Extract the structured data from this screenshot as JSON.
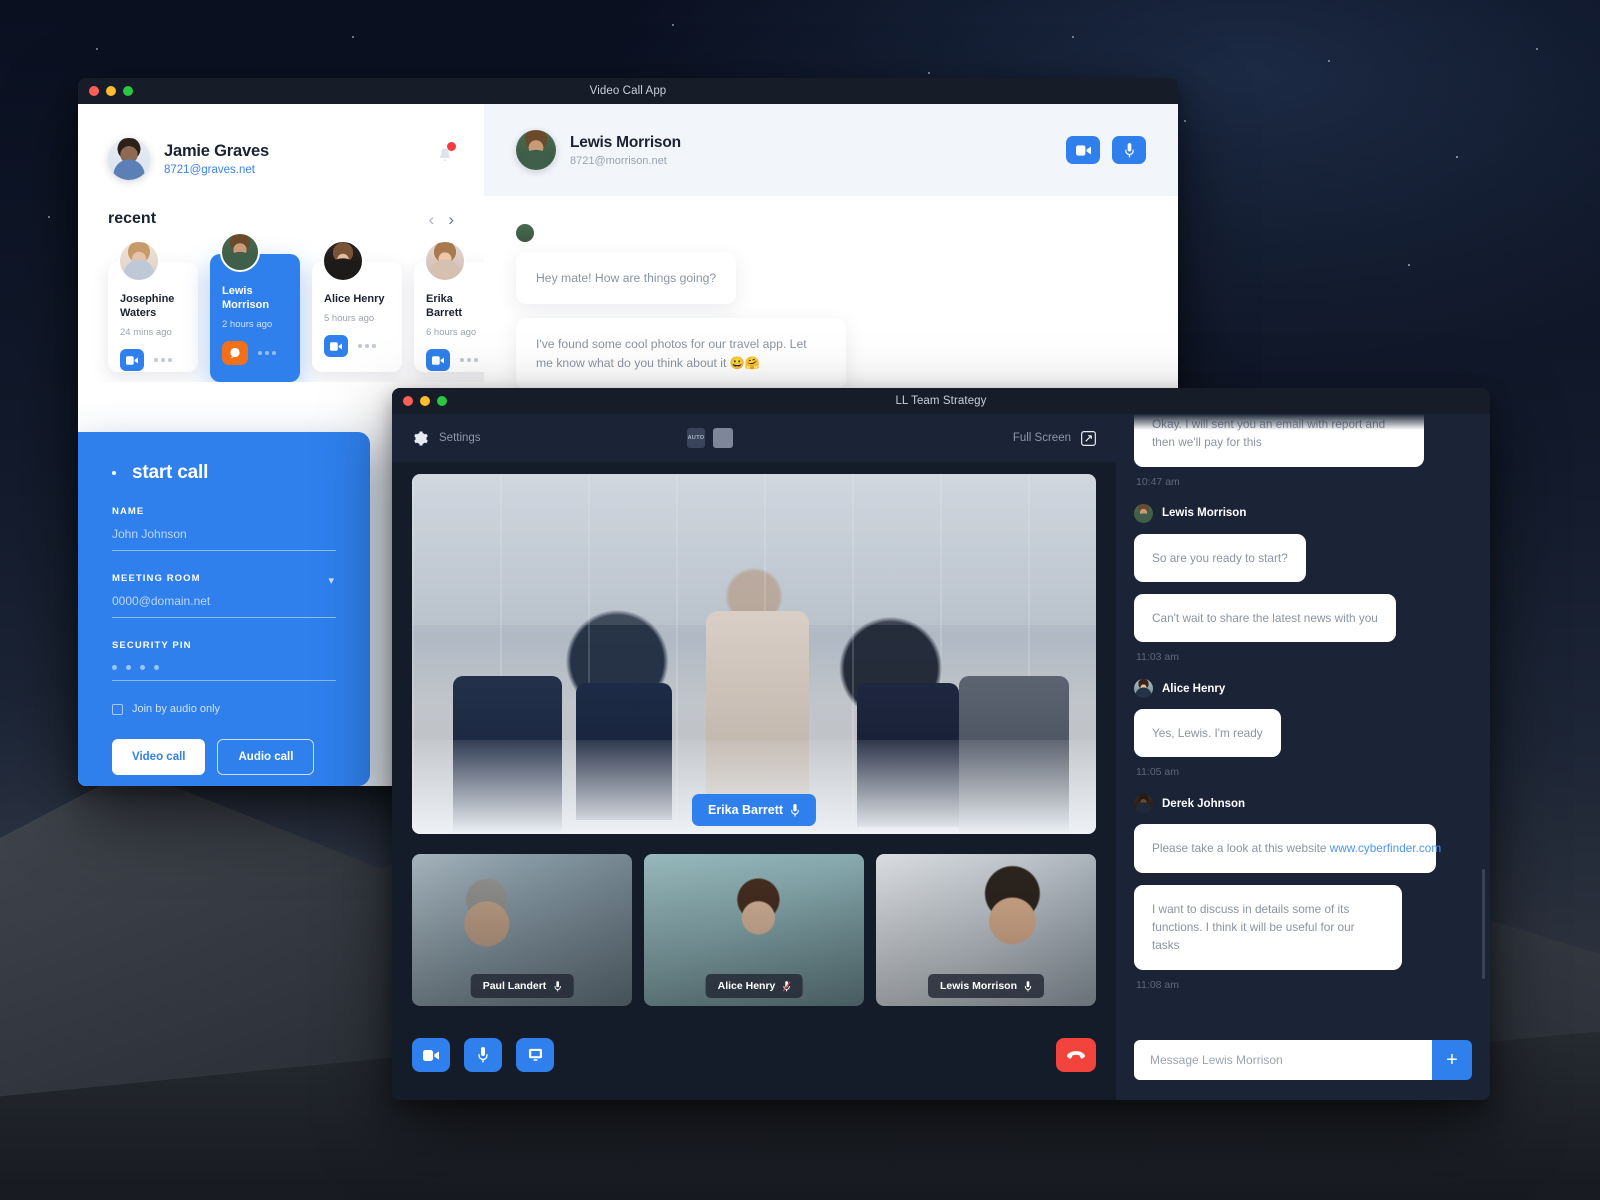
{
  "messenger_window": {
    "title": "Video Call App",
    "profile": {
      "name": "Jamie Graves",
      "handle": "8721@graves.net",
      "avatar_icon": "avatar-jamie",
      "bell_icon": "bell-icon"
    },
    "recent": {
      "heading": "recent",
      "prev_icon": "chevron-left-icon",
      "next_icon": "chevron-right-icon",
      "contacts": [
        {
          "name": "Josephine Waters",
          "time": "24 mins ago",
          "action_icon": "video-camera-icon",
          "more_icon": "more-dots-icon"
        },
        {
          "name": "Lewis Morrison",
          "time": "2 hours ago",
          "action_icon": "chat-bubble-icon",
          "more_icon": "more-dots-icon"
        },
        {
          "name": "Alice Henry",
          "time": "5 hours ago",
          "action_icon": "video-camera-icon",
          "more_icon": "more-dots-icon"
        },
        {
          "name": "Erika Barrett",
          "time": "6 hours ago",
          "action_icon": "video-camera-icon",
          "more_icon": "more-dots-icon"
        }
      ]
    },
    "start_call": {
      "title": "start call",
      "name_label": "NAME",
      "name_placeholder": "John Johnson",
      "room_label": "MEETING ROOM",
      "room_placeholder": "0000@domain.net",
      "room_chevron_icon": "chevron-down-icon",
      "pin_label": "SECURITY PIN",
      "pin_dots": 4,
      "audio_only_label": "Join by audio only",
      "video_call_button": "Video call",
      "audio_call_button": "Audio call"
    },
    "chat": {
      "peer_name": "Lewis Morrison",
      "peer_handle": "8721@morrison.net",
      "video_button_icon": "video-camera-icon",
      "mic_button_icon": "microphone-icon",
      "messages": [
        {
          "text": "Hey mate! How are things going?"
        },
        {
          "text": "I've found some cool photos for our travel app. Let me know what do you think about it 😀🤗"
        }
      ]
    }
  },
  "call_window": {
    "title": "LL Team Strategy",
    "toolbar": {
      "settings_label": "Settings",
      "settings_icon": "gear-icon",
      "fullscreen_label": "Full Screen",
      "fullscreen_icon": "expand-icon",
      "layouts": [
        {
          "name": "layout-auto",
          "label": "AUTO"
        },
        {
          "name": "layout-single",
          "label": ""
        },
        {
          "name": "layout-speaker",
          "label": ""
        },
        {
          "name": "layout-grid-2x2",
          "label": ""
        },
        {
          "name": "layout-grid-sidebar",
          "label": ""
        }
      ],
      "active_layout": "layout-speaker"
    },
    "main_speaker": {
      "name": "Erika Barrett",
      "mic_icon": "microphone-icon",
      "muted": false
    },
    "thumbnails": [
      {
        "name": "Paul Landert",
        "mic_icon": "microphone-icon",
        "muted": false
      },
      {
        "name": "Alice Henry",
        "mic_icon": "microphone-muted-icon",
        "muted": true
      },
      {
        "name": "Lewis Morrison",
        "mic_icon": "microphone-icon",
        "muted": false
      }
    ],
    "controls": [
      {
        "name": "toggle-video-button",
        "icon": "video-camera-icon"
      },
      {
        "name": "toggle-mic-button",
        "icon": "microphone-icon"
      },
      {
        "name": "share-screen-button",
        "icon": "screen-share-icon"
      },
      {
        "name": "end-call-button",
        "icon": "hang-up-icon"
      }
    ],
    "chat": {
      "messages": [
        {
          "type": "bubble",
          "text": "Okay. I will sent you an email with report and then we'll pay for this",
          "clipped": true
        },
        {
          "type": "time",
          "text": "10:47 am"
        },
        {
          "type": "author",
          "name": "Lewis Morrison",
          "avatar_icon": "avatar-lewis"
        },
        {
          "type": "bubble",
          "text": "So are you ready to start?"
        },
        {
          "type": "bubble",
          "text": "Can't wait to share the latest news with you"
        },
        {
          "type": "time",
          "text": "11:03 am"
        },
        {
          "type": "author",
          "name": "Alice Henry",
          "avatar_icon": "avatar-alice"
        },
        {
          "type": "bubble",
          "text": "Yes, Lewis. I'm ready"
        },
        {
          "type": "time",
          "text": "11:05 am"
        },
        {
          "type": "author",
          "name": "Derek Johnson",
          "avatar_icon": "avatar-derek"
        },
        {
          "type": "bubble",
          "text": "Please take a look at this website ",
          "link": "www.cyberfinder.com"
        },
        {
          "type": "bubble",
          "text": "I want to discuss in details some of its functions. I think it will be useful for our tasks"
        },
        {
          "type": "time",
          "text": "11:08 am"
        }
      ],
      "composer_placeholder": "Message Lewis Morrison",
      "add_button_icon": "plus-icon"
    }
  },
  "colors": {
    "accent": "#2f80ed",
    "danger": "#f2433d",
    "orange": "#f2701a",
    "dark": "#1b2436",
    "stage": "#141b29"
  }
}
